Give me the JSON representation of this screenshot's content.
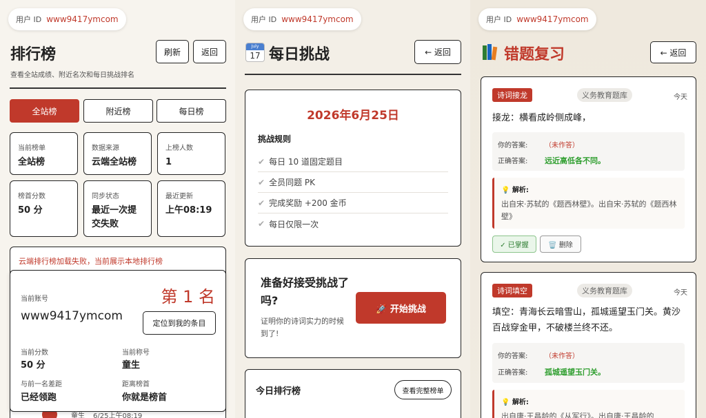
{
  "user": {
    "label": "用户 ID",
    "value": "www9417ymcom"
  },
  "leaderboard": {
    "title": "排行榜",
    "refresh_label": "刷新",
    "back_label": "返回",
    "subtitle": "查看全站成绩、附近名次和每日挑战排名",
    "tabs": [
      {
        "label": "全站榜",
        "active": true
      },
      {
        "label": "附近榜",
        "active": false
      },
      {
        "label": "每日榜",
        "active": false
      }
    ],
    "stats": [
      {
        "key": "当前榜单",
        "value": "全站榜"
      },
      {
        "key": "数据来源",
        "value": "云端全站榜"
      },
      {
        "key": "上榜人数",
        "value": "1"
      },
      {
        "key": "榜首分数",
        "value": "50 分"
      },
      {
        "key": "同步状态",
        "value": "最近一次提交失败"
      },
      {
        "key": "最近更新",
        "value": "上午08:19"
      }
    ],
    "error_message": "云端排行榜加载失败，当前展示本地排行榜",
    "my_card": {
      "account_label": "当前账号",
      "account_value": "www9417ymcom",
      "rank": "第 1 名",
      "locate_label": "定位到我的条目",
      "score_label": "当前分数",
      "score_value": "50 分",
      "title_label": "当前称号",
      "title_value": "童生",
      "gap_label": "与前一名差距",
      "gap_value": "已经领跑",
      "top_label": "距离榜首",
      "top_value": "你就是榜首"
    },
    "peek_row": {
      "name": "童生",
      "time": "6/25上午08:19"
    }
  },
  "daily": {
    "icon": "calendar-icon",
    "calendar_month": "July",
    "calendar_day": "17",
    "title": "每日挑战",
    "back_label": "← 返回",
    "date": "2026年6月25日",
    "rules_title": "挑战规则",
    "rules": [
      "每日 10 道固定题目",
      "全员同题 PK",
      "完成奖励 +200 金币",
      "每日仅限一次"
    ],
    "ready_title": "准备好接受挑战了吗?",
    "ready_desc": "证明你的诗词实力的时候到了!",
    "start_label": "🚀 开始挑战",
    "today_rank_title": "今日排行榜",
    "full_rank_label": "查看完整榜单"
  },
  "review": {
    "icon": "books-icon",
    "title": "错题复习",
    "back_label": "← 返回",
    "colors": {
      "accent": "#c0392b",
      "correct": "#2e9e2e"
    },
    "items": [
      {
        "type": "诗词接龙",
        "bank": "义务教育题库",
        "time": "今天",
        "question": "接龙：横看成岭侧成峰，",
        "your_answer_label": "你的答案:",
        "your_answer": "（未作答）",
        "correct_label": "正确答案:",
        "correct_answer": "远近高低各不同。",
        "explain_label": "解析:",
        "explain_text": "出自宋·苏轼的《题西林壁》。出自宋·苏轼的《题西林壁》",
        "mastered_label": "✓ 已掌握",
        "delete_label": "🗑️ 删除"
      },
      {
        "type": "诗词填空",
        "bank": "义务教育题库",
        "time": "今天",
        "question": "填空：青海长云暗雪山，孤城遥望玉门关。黄沙百战穿金甲，不破楼兰终不还。",
        "your_answer_label": "你的答案:",
        "your_answer": "（未作答）",
        "correct_label": "正确答案:",
        "correct_answer": "孤城遥望玉门关。",
        "explain_label": "解析:",
        "explain_text": "出自唐·王昌龄的《从军行》。出自唐·王昌龄的"
      }
    ]
  }
}
